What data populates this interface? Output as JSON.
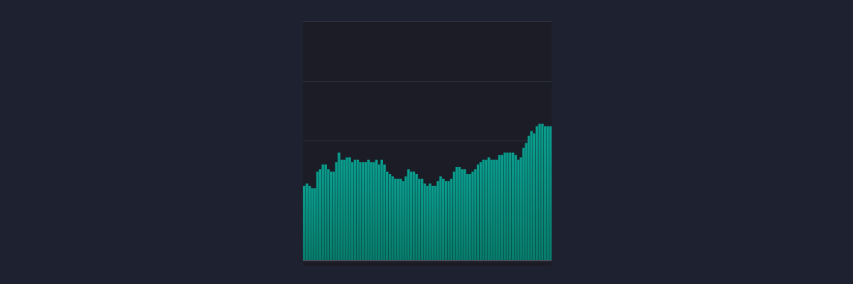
{
  "colors": {
    "page_background": "#1e2230",
    "plot_background": "#1b1c26",
    "gridline": "#2f3341",
    "baseline": "#4a4d58",
    "bar_top": "#0b9e8f",
    "bar_bottom": "#087d6d",
    "bar_edge": "#0a3b38"
  },
  "chart_data": {
    "type": "bar",
    "title": "",
    "xlabel": "",
    "ylabel": "",
    "ylim": [
      0,
      100
    ],
    "grid": true,
    "y_gridlines": [
      50,
      75,
      100
    ],
    "legend": "none",
    "values": [
      31,
      32,
      31,
      30,
      30,
      37,
      38,
      40,
      40,
      38,
      37,
      37,
      41,
      45,
      42,
      42,
      43,
      43,
      41,
      42,
      42,
      41,
      41,
      41,
      42,
      41,
      41,
      42,
      40,
      42,
      40,
      37,
      36,
      35,
      34,
      34,
      34,
      33,
      35,
      38,
      37,
      37,
      36,
      34,
      34,
      32,
      31,
      32,
      31,
      31,
      33,
      35,
      34,
      33,
      33,
      34,
      37,
      39,
      39,
      38,
      38,
      36,
      36,
      37,
      38,
      40,
      41,
      42,
      42,
      43,
      42,
      42,
      42,
      44,
      44,
      45,
      45,
      45,
      45,
      44,
      42,
      43,
      47,
      49,
      52,
      54,
      53,
      56,
      57,
      57,
      56,
      56,
      56
    ]
  }
}
